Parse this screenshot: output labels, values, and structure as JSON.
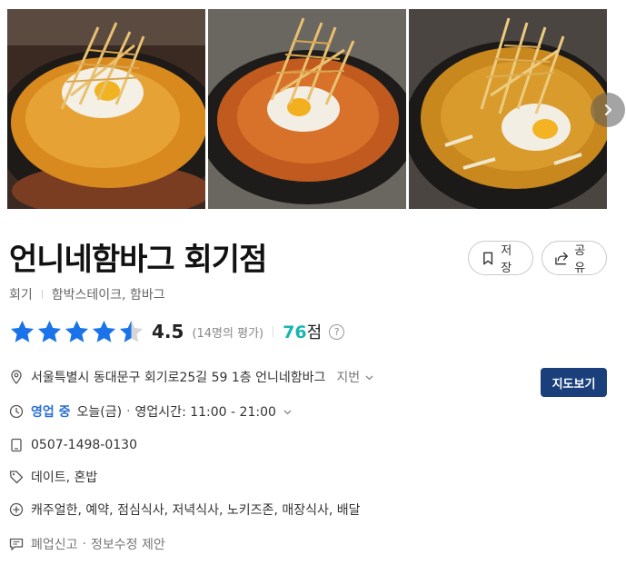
{
  "place": {
    "name": "언니네함바그 회기점",
    "area": "회기",
    "category": "함박스테이크, 함바그"
  },
  "actions": {
    "save_label": "저장",
    "share_label": "공유"
  },
  "rating": {
    "score": "4.5",
    "stars_filled": 4.5,
    "reviews": "(14명의 평가)",
    "points_value": "76",
    "points_unit": "점",
    "help_glyph": "?"
  },
  "address": {
    "text": "서울특별시 동대문구 회기로25길 59 1층 언니네함바그",
    "jibun_label": "지번",
    "map_button": "지도보기"
  },
  "hours": {
    "status": "영업 중",
    "today": "오늘(금)",
    "dot": "·",
    "detail": "영업시간: 11:00 - 21:00"
  },
  "phone": "0507-1498-0130",
  "tags": "데이트, 혼밥",
  "facilities": "캐주얼한, 예약, 점심식사, 저녁식사, 노키즈존, 매장식사, 배달",
  "report": {
    "close_label": "폐업신고",
    "dot": "·",
    "edit_label": "정보수정 제안"
  },
  "colors": {
    "star": "#1a73e8",
    "points": "#1ab3b3",
    "open_status": "#2a6fd3",
    "map_button": "#1a3f7a"
  }
}
